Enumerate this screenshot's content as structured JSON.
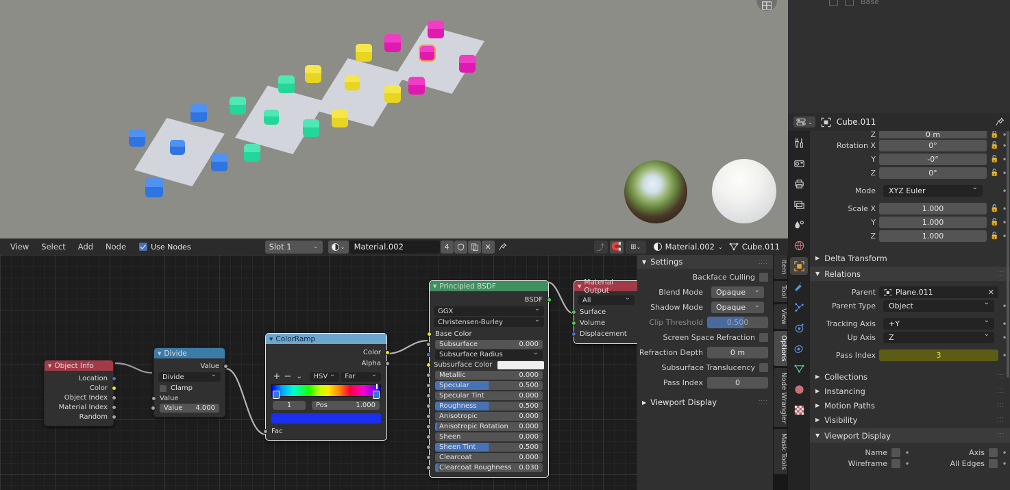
{
  "viewport": {
    "name": "3d-viewport",
    "background_color": "#8d8d87",
    "gizmo_icon": "grid-overlay-icon",
    "plane_color": "#d2d5dc",
    "groups": [
      {
        "label": "group-blue",
        "cube_color": "#2f74e0",
        "cube_top": "#4f92f2"
      },
      {
        "label": "group-green",
        "cube_color": "#23d69a",
        "cube_top": "#4fe8b5"
      },
      {
        "label": "group-yellow",
        "cube_color": "#e8d521",
        "cube_top": "#f5e64a"
      },
      {
        "label": "group-magenta",
        "cube_color": "#e01ab0",
        "cube_top": "#f23cc7"
      }
    ],
    "selection_outline_color": "#f5a03c",
    "preview_balls": [
      "reflection-ball",
      "diffuse-ball"
    ]
  },
  "node_header": {
    "menus": [
      "View",
      "Select",
      "Add",
      "Node"
    ],
    "use_nodes_label": "Use Nodes",
    "use_nodes_checked": true,
    "slot_select": "Slot 1",
    "material_browse_icon": "material-sphere-icon",
    "material_name": "Material.002",
    "users_count": "4",
    "fake_user_icon": "shield-icon",
    "duplicate_icon": "copy-icon",
    "unlink_icon": "x-icon",
    "pin_icon": "pin-icon",
    "go_parent_icon": "arrow-up-icon",
    "snap_magnet_icon": "magnet-icon",
    "snap_target_icon": "snap-grid-icon",
    "breadcrumb_material_icon": "material-sphere-icon",
    "breadcrumb_material": "Material.002",
    "breadcrumb_object_icon": "mesh-data-icon",
    "breadcrumb_object": "Cube.011"
  },
  "nodes": {
    "object_info": {
      "title": "Object Info",
      "header_color": "#a33a47",
      "outputs": [
        "Location",
        "Color",
        "Object Index",
        "Material Index",
        "Random"
      ],
      "socket_colors": [
        "#6363d0",
        "#e6e62e",
        "#a1a1a1",
        "#a1a1a1",
        "#a1a1a1"
      ]
    },
    "divide": {
      "title": "Divide",
      "header_color": "#3b7ba8",
      "output_label": "Value",
      "operation": "Divide",
      "clamp_label": "Clamp",
      "clamp_checked": false,
      "input_label": "Value",
      "input_value_label": "Value",
      "input_value": "4.000"
    },
    "color_ramp": {
      "title": "ColorRamp",
      "header_color": "#6ca6cf",
      "outputs": [
        "Color",
        "Alpha"
      ],
      "add_icon": "plus-icon",
      "remove_icon": "minus-icon",
      "menu_icon": "chevron-down-icon",
      "interpolation": "HSV",
      "color_mode": "Far",
      "index": "1",
      "pos_label": "Pos",
      "pos_value": "1.000",
      "selected_color": "#1a2ff0",
      "input_label": "Fac"
    },
    "principled_bsdf": {
      "title": "Principled BSDF",
      "header_color": "#3f8f5f",
      "output_label": "BSDF",
      "distribution": "GGX",
      "subsurface_method": "Christensen-Burley",
      "inputs": [
        {
          "label": "Base Color",
          "value": "",
          "socket": "#e6e62e",
          "type": "color-link"
        },
        {
          "label": "Subsurface",
          "value": "0.000",
          "socket": "#a1a1a1",
          "type": "slider",
          "fill": 0
        },
        {
          "label": "Subsurface Radius",
          "value": "",
          "socket": "#6363d0",
          "type": "dropdown"
        },
        {
          "label": "Subsurface Color",
          "value": "",
          "socket": "#e6e62e",
          "type": "swatch",
          "color": "#efefef"
        },
        {
          "label": "Metallic",
          "value": "0.000",
          "socket": "#a1a1a1",
          "type": "slider",
          "fill": 0
        },
        {
          "label": "Specular",
          "value": "0.500",
          "socket": "#a1a1a1",
          "type": "slider",
          "fill": 50
        },
        {
          "label": "Specular Tint",
          "value": "0.000",
          "socket": "#a1a1a1",
          "type": "slider",
          "fill": 0
        },
        {
          "label": "Roughness",
          "value": "0.500",
          "socket": "#a1a1a1",
          "type": "slider",
          "fill": 50
        },
        {
          "label": "Anisotropic",
          "value": "0.000",
          "socket": "#a1a1a1",
          "type": "slider",
          "fill": 0
        },
        {
          "label": "Anisotropic Rotation",
          "value": "0.000",
          "socket": "#a1a1a1",
          "type": "slider",
          "fill": 0
        },
        {
          "label": "Sheen",
          "value": "0.000",
          "socket": "#a1a1a1",
          "type": "slider",
          "fill": 0
        },
        {
          "label": "Sheen Tint",
          "value": "0.500",
          "socket": "#a1a1a1",
          "type": "slider",
          "fill": 50
        },
        {
          "label": "Clearcoat",
          "value": "0.000",
          "socket": "#a1a1a1",
          "type": "slider",
          "fill": 0
        },
        {
          "label": "Clearcoat Roughness",
          "value": "0.030",
          "socket": "#a1a1a1",
          "type": "slider",
          "fill": 3
        }
      ]
    },
    "material_output": {
      "title": "Material Output",
      "header_color": "#a33a47",
      "target": "All",
      "inputs": [
        "Surface",
        "Volume",
        "Displacement"
      ],
      "socket_colors": [
        "#4fd04f",
        "#4fd04f",
        "#6363d0"
      ]
    }
  },
  "npanel": {
    "tabs": [
      "Item",
      "Tool",
      "View",
      "Options",
      "Node Wrangler",
      "Mask Tools"
    ],
    "active_tab": "Options",
    "settings": {
      "title": "Settings",
      "rows": [
        {
          "label": "Backface Culling",
          "kind": "check",
          "value": ""
        },
        {
          "label": "Blend Mode",
          "kind": "dropdown",
          "value": "Opaque"
        },
        {
          "label": "Shadow Mode",
          "kind": "dropdown",
          "value": "Opaque"
        },
        {
          "label": "Clip Threshold",
          "kind": "slider",
          "value": "0.500",
          "disabled": true
        },
        {
          "label": "Screen Space Refraction",
          "kind": "check",
          "value": ""
        },
        {
          "label": "Refraction Depth",
          "kind": "value",
          "value": "0 m"
        },
        {
          "label": "Subsurface Translucency",
          "kind": "check",
          "value": ""
        },
        {
          "label": "Pass Index",
          "kind": "value",
          "value": "0"
        }
      ]
    },
    "viewport_display_title": "Viewport Display"
  },
  "properties": {
    "header": {
      "editor_icon": "properties-editor-icon",
      "object_icon": "object-icon",
      "object_name": "Cube.011",
      "pin_icon": "pin-icon"
    },
    "tabs": [
      "tool-icon",
      "render-icon",
      "output-icon",
      "view-layer-icon",
      "scene-icon",
      "world-icon",
      "object-icon",
      "modifier-icon",
      "particles-icon",
      "physics-icon",
      "constraints-icon",
      "object-data-icon",
      "material-icon",
      "texture-icon"
    ],
    "active_tab_index": 6,
    "transform": {
      "cut_row_label": "Z",
      "cut_row_value": "0 m",
      "rows": [
        {
          "label": "Rotation X",
          "value": "0°"
        },
        {
          "label": "Y",
          "value": "-0°"
        },
        {
          "label": "Z",
          "value": "0°"
        }
      ],
      "mode_label": "Mode",
      "mode_value": "XYZ Euler",
      "scale_rows": [
        {
          "label": "Scale X",
          "value": "1.000"
        },
        {
          "label": "Y",
          "value": "1.000"
        },
        {
          "label": "Z",
          "value": "1.000"
        }
      ]
    },
    "delta_transform_title": "Delta Transform",
    "relations": {
      "title": "Relations",
      "parent_label": "Parent",
      "parent_icon": "object-icon",
      "parent_value": "Plane.011",
      "parent_clear_icon": "x-icon",
      "parent_type_label": "Parent Type",
      "parent_type_value": "Object",
      "tracking_axis_label": "Tracking Axis",
      "tracking_axis_value": "+Y",
      "up_axis_label": "Up Axis",
      "up_axis_value": "Z",
      "pass_index_label": "Pass Index",
      "pass_index_value": "3",
      "pass_index_color": "#e0e04a"
    },
    "collapsed": [
      "Collections",
      "Instancing",
      "Motion Paths",
      "Visibility"
    ],
    "viewport_display": {
      "title": "Viewport Display",
      "rows": [
        {
          "left": "Name",
          "right": "Axis"
        },
        {
          "left": "Wireframe",
          "right": "All Edges"
        }
      ]
    }
  }
}
